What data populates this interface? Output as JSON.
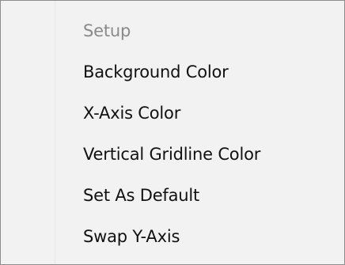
{
  "context_menu": {
    "items": [
      {
        "label": "Setup",
        "enabled": false
      },
      {
        "label": "Background Color",
        "enabled": true
      },
      {
        "label": "X-Axis Color",
        "enabled": true
      },
      {
        "label": "Vertical Gridline Color",
        "enabled": true
      },
      {
        "label": "Set As Default",
        "enabled": true
      },
      {
        "label": "Swap Y-Axis",
        "enabled": true
      }
    ]
  }
}
